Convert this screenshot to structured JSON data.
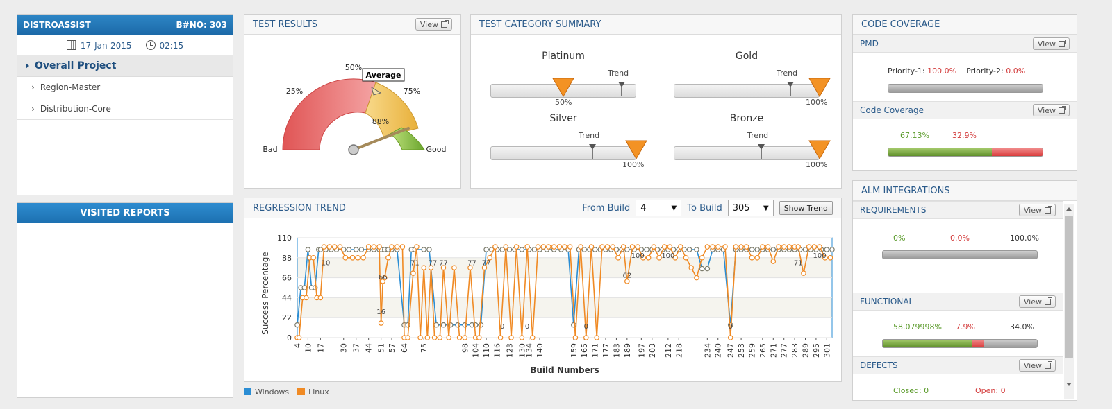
{
  "app": {
    "title": "DISTROASSIST",
    "build_no": "B#NO: 303",
    "date": "17-Jan-2015",
    "time": "02:15"
  },
  "nav": {
    "project": "Overall Project",
    "items": [
      {
        "label": "Region-Master"
      },
      {
        "label": "Distribution-Core"
      }
    ]
  },
  "visited_reports": "VISITED REPORTS",
  "test_results": {
    "title": "TEST RESULTS",
    "view": "View",
    "gauge": {
      "value_pct": 88,
      "value_label": "88%",
      "tooltip": "Average",
      "labels": {
        "bad": "Bad",
        "p25": "25%",
        "p50": "50%",
        "p75": "75%",
        "good": "Good"
      }
    }
  },
  "category": {
    "title": "TEST CATEGORY SUMMARY",
    "trend_label": "Trend",
    "items": [
      {
        "name": "Platinum",
        "value": 50,
        "pct": "50%",
        "trend": 0.9
      },
      {
        "name": "Gold",
        "value": 100,
        "pct": "100%",
        "trend": 0.8
      },
      {
        "name": "Silver",
        "value": 100,
        "pct": "100%",
        "trend": 0.7
      },
      {
        "name": "Bronze",
        "value": 100,
        "pct": "100%",
        "trend": 0.6
      }
    ]
  },
  "regression": {
    "title": "REGRESSION TREND",
    "from_label": "From Build",
    "from_value": "4",
    "to_label": "To Build",
    "to_value": "305",
    "show_trend": "Show Trend"
  },
  "chart_data": {
    "type": "line",
    "xlabel": "Build Numbers",
    "ylabel": "Success Percentage",
    "ylim": [
      0,
      110
    ],
    "y_ticks": [
      0,
      22,
      44,
      66,
      88,
      110
    ],
    "x_ticks": [
      4,
      10,
      17,
      30,
      37,
      44,
      51,
      57,
      64,
      75,
      98,
      104,
      110,
      116,
      123,
      130,
      134,
      140,
      159,
      165,
      171,
      177,
      183,
      189,
      197,
      203,
      212,
      218,
      234,
      240,
      247,
      253,
      259,
      265,
      271,
      277,
      283,
      289,
      295,
      301
    ],
    "grid": true,
    "legend_position": "bottom-left",
    "point_labels": [
      "10",
      "66",
      "16",
      "71",
      "77",
      "77",
      "77",
      "77",
      "0",
      "0",
      "0",
      "62",
      "100",
      "100",
      "0",
      "71",
      "100"
    ],
    "series": [
      {
        "name": "Windows",
        "color": "#2a8dd4",
        "x": [
          4,
          6,
          8,
          10,
          12,
          14,
          16,
          17,
          20,
          23,
          26,
          30,
          33,
          37,
          40,
          44,
          47,
          50,
          51,
          53,
          55,
          57,
          60,
          64,
          66,
          68,
          70,
          75,
          78,
          82,
          86,
          90,
          94,
          98,
          102,
          104,
          107,
          110,
          113,
          116,
          119,
          123,
          126,
          130,
          134,
          137,
          140,
          144,
          148,
          152,
          156,
          159,
          162,
          165,
          168,
          171,
          174,
          177,
          180,
          183,
          186,
          189,
          193,
          197,
          200,
          203,
          206,
          209,
          212,
          215,
          218,
          221,
          224,
          228,
          231,
          234,
          237,
          240,
          243,
          247,
          250,
          253,
          256,
          259,
          262,
          265,
          268,
          271,
          274,
          277,
          280,
          283,
          286,
          289,
          292,
          295,
          298,
          301,
          304
        ],
        "y": [
          14,
          55,
          55,
          97,
          55,
          55,
          97,
          97,
          97,
          97,
          97,
          97,
          97,
          97,
          97,
          97,
          97,
          97,
          97,
          97,
          97,
          97,
          97,
          14,
          14,
          97,
          97,
          97,
          97,
          14,
          14,
          14,
          14,
          14,
          14,
          14,
          14,
          97,
          97,
          97,
          97,
          97,
          97,
          97,
          97,
          97,
          97,
          97,
          97,
          97,
          97,
          14,
          97,
          97,
          97,
          97,
          97,
          97,
          97,
          97,
          97,
          97,
          97,
          97,
          97,
          97,
          97,
          97,
          97,
          97,
          97,
          97,
          97,
          97,
          76,
          76,
          97,
          97,
          97,
          14,
          97,
          97,
          97,
          97,
          97,
          97,
          97,
          97,
          97,
          97,
          97,
          97,
          97,
          97,
          97,
          97,
          97,
          97,
          97
        ]
      },
      {
        "name": "Linux",
        "color": "#f08a24",
        "x": [
          4,
          5,
          7,
          9,
          11,
          13,
          15,
          17,
          19,
          22,
          25,
          28,
          31,
          35,
          38,
          41,
          44,
          47,
          50,
          51,
          52,
          53,
          55,
          57,
          60,
          63,
          64,
          66,
          69,
          71,
          73,
          75,
          77,
          79,
          81,
          84,
          86,
          89,
          92,
          95,
          98,
          101,
          104,
          106,
          109,
          112,
          115,
          118,
          121,
          124,
          127,
          130,
          133,
          136,
          139,
          142,
          145,
          148,
          151,
          154,
          157,
          160,
          163,
          166,
          169,
          172,
          175,
          178,
          181,
          184,
          187,
          189,
          192,
          195,
          198,
          201,
          204,
          207,
          210,
          213,
          216,
          219,
          222,
          225,
          228,
          231,
          234,
          237,
          240,
          244,
          247,
          250,
          253,
          256,
          259,
          262,
          265,
          268,
          271,
          274,
          277,
          280,
          283,
          285,
          288,
          291,
          294,
          297,
          300,
          303
        ],
        "y": [
          0,
          0,
          44,
          44,
          88,
          88,
          44,
          44,
          100,
          100,
          100,
          100,
          88,
          88,
          88,
          88,
          100,
          100,
          100,
          16,
          62,
          66,
          88,
          100,
          100,
          100,
          0,
          0,
          71,
          100,
          0,
          77,
          0,
          77,
          0,
          0,
          77,
          0,
          77,
          0,
          0,
          77,
          0,
          0,
          77,
          88,
          100,
          0,
          100,
          0,
          100,
          0,
          100,
          0,
          100,
          100,
          100,
          100,
          100,
          100,
          100,
          0,
          100,
          0,
          100,
          0,
          100,
          100,
          100,
          88,
          100,
          62,
          100,
          100,
          88,
          88,
          100,
          88,
          100,
          100,
          88,
          100,
          88,
          77,
          66,
          88,
          100,
          100,
          100,
          100,
          0,
          100,
          100,
          100,
          88,
          88,
          100,
          100,
          84,
          100,
          100,
          100,
          100,
          100,
          71,
          100,
          100,
          100,
          88,
          88
        ]
      }
    ]
  },
  "legend": [
    {
      "name": "Windows",
      "color": "#2a8dd4"
    },
    {
      "name": "Linux",
      "color": "#f08a24"
    }
  ],
  "coverage": {
    "title": "CODE COVERAGE",
    "pmd": {
      "title": "PMD",
      "view": "View",
      "p1_label": "Priority-1:",
      "p1_value": "100.0%",
      "p2_label": "Priority-2:",
      "p2_value": "0.0%",
      "green": 0,
      "red": 0
    },
    "code": {
      "title": "Code Coverage",
      "view": "View",
      "covered": "67.13%",
      "uncovered": "32.9%",
      "green": 0.671,
      "red": 0.329
    }
  },
  "alm": {
    "title": "ALM INTEGRATIONS",
    "requirements": {
      "title": "REQUIREMENTS",
      "view": "View",
      "a": "0%",
      "b": "0.0%",
      "c": "100.0%",
      "green": 0,
      "red": 0
    },
    "functional": {
      "title": "FUNCTIONAL",
      "view": "View",
      "a": "58.079998%",
      "b": "7.9%",
      "c": "34.0%",
      "green": 0.58,
      "red": 0.079
    },
    "defects": {
      "title": "DEFECTS",
      "view": "View",
      "closed": "Closed: 0",
      "open": "Open: 0"
    }
  }
}
